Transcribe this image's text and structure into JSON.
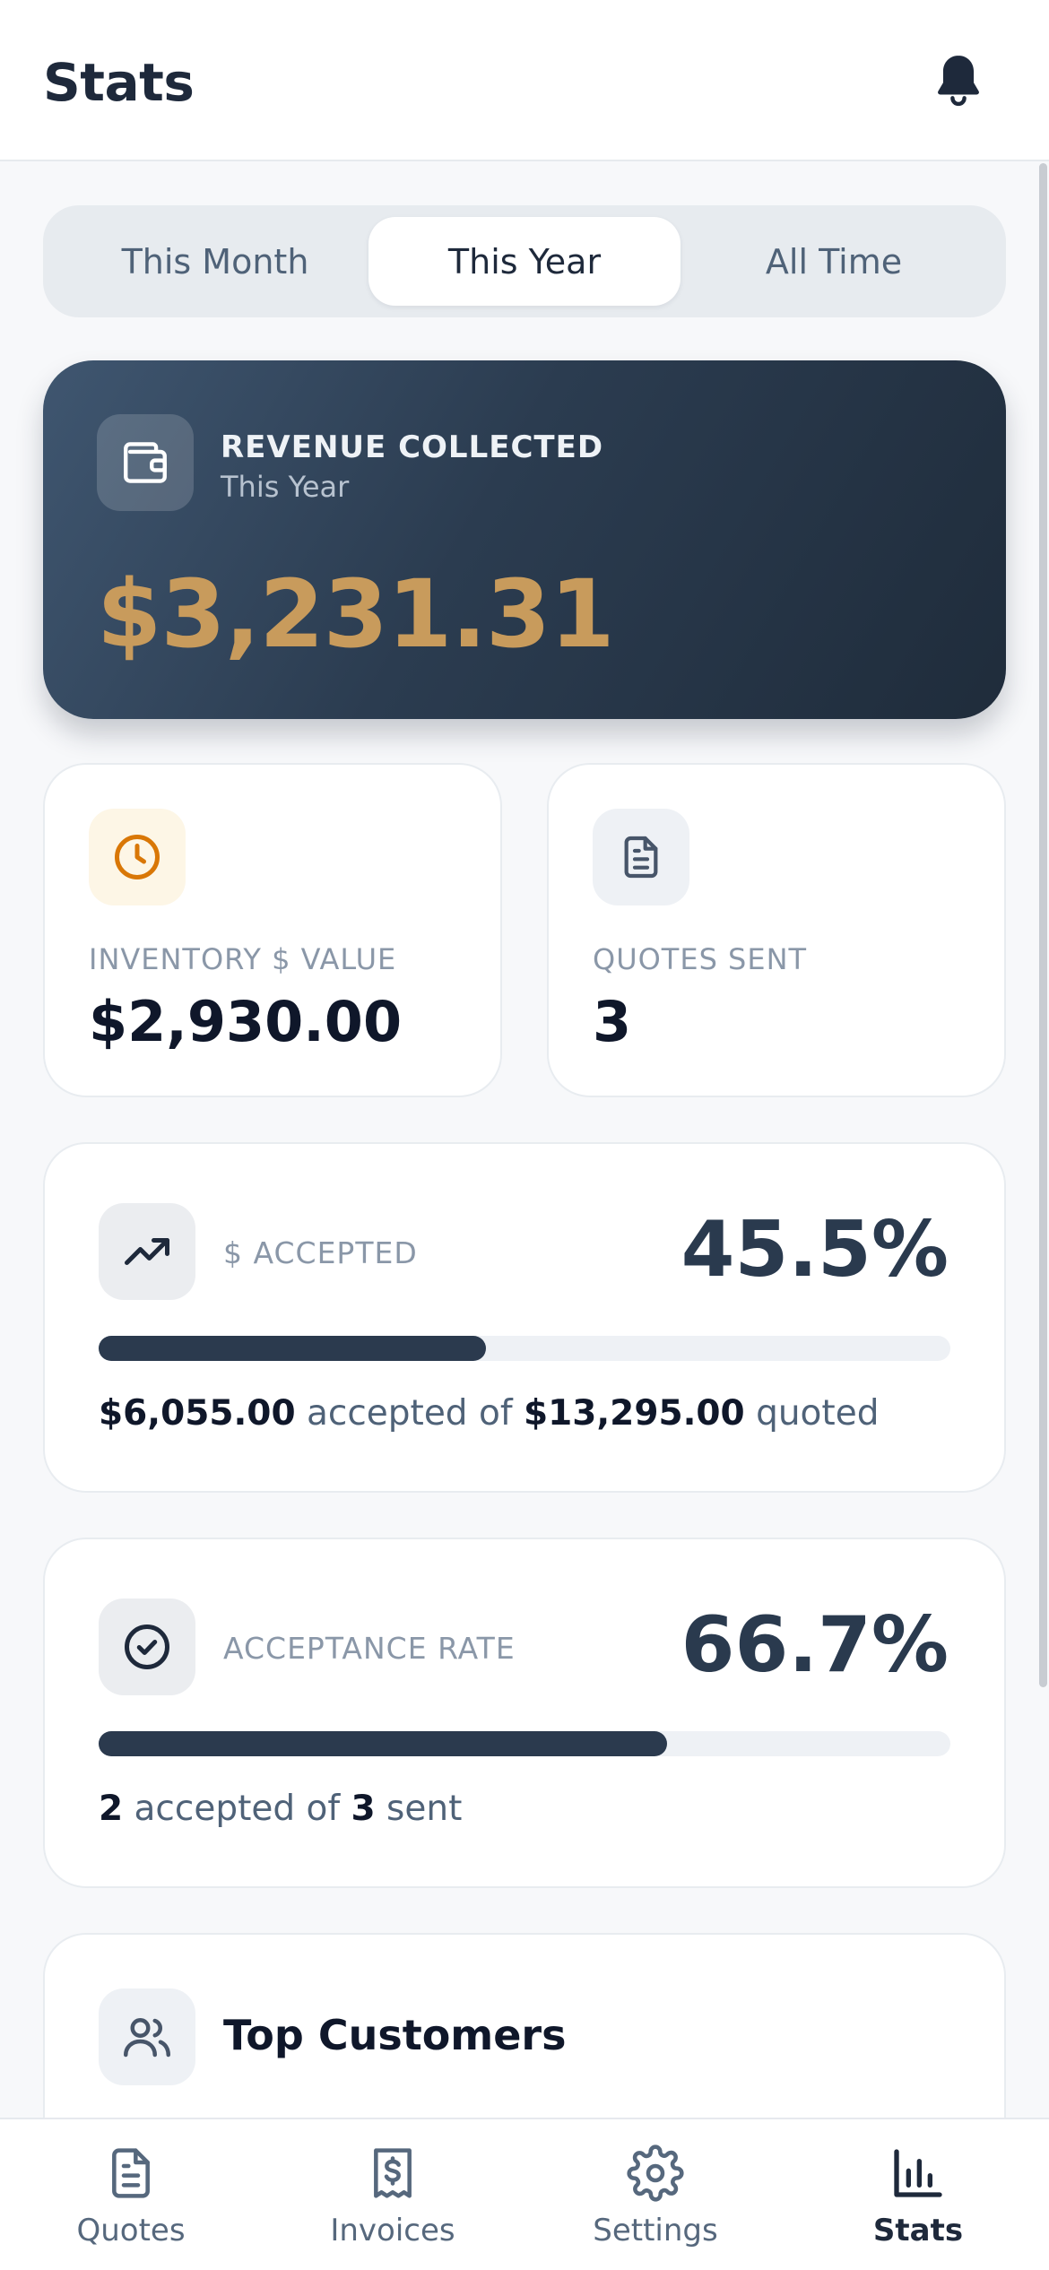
{
  "header": {
    "title": "Stats",
    "bell_icon": "bell-icon"
  },
  "tabs": [
    {
      "label": "This Month",
      "active": false
    },
    {
      "label": "This Year",
      "active": true
    },
    {
      "label": "All Time",
      "active": false
    }
  ],
  "revenue": {
    "label": "REVENUE COLLECTED",
    "period": "This Year",
    "amount": "$3,231.31",
    "icon": "wallet-icon",
    "amount_color": "#c89b5c"
  },
  "inventory": {
    "label": "INVENTORY $ VALUE",
    "value": "$2,930.00",
    "icon": "clock-icon",
    "icon_color": "#d97706"
  },
  "quotes_sent": {
    "label": "QUOTES SENT",
    "value": "3",
    "icon": "document-icon"
  },
  "dollar_accepted": {
    "label": "$ ACCEPTED",
    "percent": "45.5%",
    "progress": 0.455,
    "accepted_amount": "$6,055.00",
    "text_accepted_of": " accepted of ",
    "quoted_amount": "$13,295.00",
    "text_quoted": " quoted",
    "icon": "trending-up-icon"
  },
  "acceptance_rate": {
    "label": "ACCEPTANCE RATE",
    "percent": "66.7%",
    "progress": 0.667,
    "accepted_count": "2",
    "text_accepted_of": " accepted of ",
    "sent_count": "3",
    "text_sent": " sent",
    "icon": "check-circle-icon"
  },
  "top_customers": {
    "title": "Top Customers",
    "icon": "users-icon"
  },
  "bottom_nav": [
    {
      "label": "Quotes",
      "icon": "document-icon",
      "active": false
    },
    {
      "label": "Invoices",
      "icon": "receipt-icon",
      "active": false
    },
    {
      "label": "Settings",
      "icon": "gear-icon",
      "active": false
    },
    {
      "label": "Stats",
      "icon": "bar-chart-icon",
      "active": true
    }
  ],
  "colors": {
    "accent": "#2b3a4e",
    "gold": "#c89b5c",
    "muted": "#8a97a8"
  }
}
